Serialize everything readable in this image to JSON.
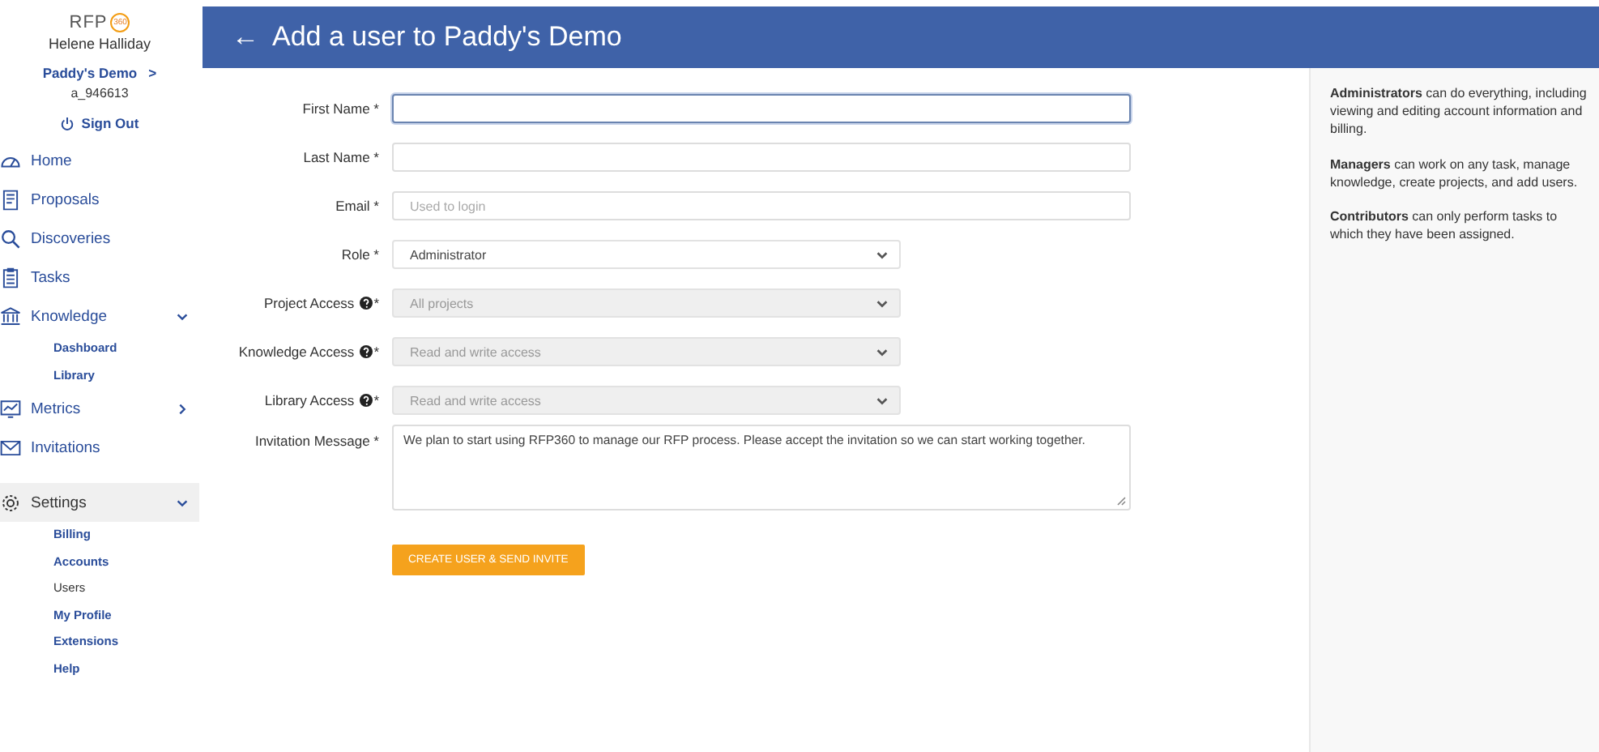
{
  "sidebar": {
    "logo": {
      "text": "RFP",
      "badge": "360"
    },
    "user_name": "Helene Halliday",
    "account": {
      "name": "Paddy's Demo",
      "chevron": ">"
    },
    "account_id": "a_946613",
    "sign_out": "Sign Out",
    "nav": [
      {
        "label": "Home",
        "selected": false
      },
      {
        "label": "Proposals",
        "selected": false
      },
      {
        "label": "Discoveries",
        "selected": false
      },
      {
        "label": "Tasks",
        "selected": false
      },
      {
        "label": "Knowledge",
        "selected": false,
        "expanded": true,
        "children": [
          {
            "label": "Dashboard",
            "selected": false
          },
          {
            "label": "Library",
            "selected": false
          }
        ]
      },
      {
        "label": "Metrics",
        "selected": false,
        "expanded": false
      },
      {
        "label": "Invitations",
        "selected": false
      },
      {
        "label": "Settings",
        "selected": true,
        "expanded": true,
        "children": [
          {
            "label": "Billing",
            "selected": false
          },
          {
            "label": "Accounts",
            "selected": false
          },
          {
            "label": "Users",
            "selected": true
          },
          {
            "label": "My Profile",
            "selected": false
          },
          {
            "label": "Extensions",
            "selected": false
          },
          {
            "label": "Help",
            "selected": false
          }
        ]
      }
    ]
  },
  "header": {
    "back": "←",
    "title": "Add a user to Paddy's Demo"
  },
  "form": {
    "fields": [
      {
        "label": "First Name *",
        "kind": "text",
        "help": false,
        "focused": true,
        "disabled": false
      },
      {
        "label": "Last Name *",
        "kind": "text",
        "help": false,
        "focused": false,
        "disabled": false
      },
      {
        "label": "Email *",
        "kind": "text",
        "help": false,
        "focused": false,
        "disabled": false,
        "placeholder": "Used to login"
      },
      {
        "label": "Role *",
        "kind": "select",
        "help": false,
        "focused": false,
        "disabled": false,
        "value": "Administrator"
      },
      {
        "label": "Project Access",
        "required_mark": "*",
        "kind": "select",
        "help": true,
        "focused": false,
        "disabled": true,
        "value": "All projects"
      },
      {
        "label": "Knowledge Access",
        "required_mark": "*",
        "kind": "select",
        "help": true,
        "focused": false,
        "disabled": true,
        "value": "Read and write access"
      },
      {
        "label": "Library Access",
        "required_mark": "*",
        "kind": "select",
        "help": true,
        "focused": false,
        "disabled": true,
        "value": "Read and write access"
      },
      {
        "label": "Invitation Message *",
        "kind": "textarea",
        "help": false,
        "focused": false,
        "disabled": false,
        "value": "We plan to start using RFP360 to manage our RFP process.  Please accept the invitation so we can start working together."
      }
    ],
    "submit": "CREATE USER & SEND INVITE"
  },
  "help_panel": [
    "**Administrators** can do everything, including viewing and editing account information and billing.",
    "**Managers** can work on any task, manage knowledge, create projects, and add users.",
    "**Contributors** can only perform tasks to which they have been assigned."
  ]
}
